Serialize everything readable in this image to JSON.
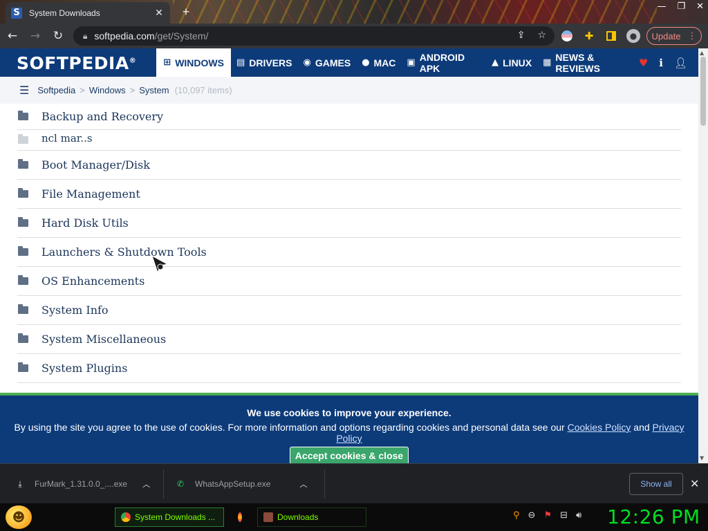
{
  "browser": {
    "tab_title": "System Downloads",
    "tab_favicon": "S",
    "url_host": "softpedia.com",
    "url_path": "/get/System/",
    "update_label": "Update",
    "window_controls": [
      "—",
      "❐",
      "✕"
    ]
  },
  "site": {
    "logo": "SOFTPEDIA",
    "logo_mark": "®",
    "nav": [
      {
        "label": "WINDOWS",
        "icon": "windows-icon",
        "active": true
      },
      {
        "label": "DRIVERS",
        "icon": "drivers-icon"
      },
      {
        "label": "GAMES",
        "icon": "gamepad-icon"
      },
      {
        "label": "MAC",
        "icon": "apple-icon"
      },
      {
        "label": "ANDROID APK",
        "icon": "android-icon"
      },
      {
        "label": "LINUX",
        "icon": "linux-icon"
      },
      {
        "label": "NEWS & REVIEWS",
        "icon": "news-icon"
      }
    ]
  },
  "breadcrumb": {
    "items": [
      "Softpedia",
      "Windows",
      "System"
    ],
    "separator": ">",
    "count": "(10,097 items)"
  },
  "categories": [
    "Backup and Recovery",
    "ncl mar..s",
    "Boot Manager/Disk",
    "File Management",
    "Hard Disk Utils",
    "Launchers & Shutdown Tools",
    "OS Enhancements",
    "System Info",
    "System Miscellaneous",
    "System Plugins"
  ],
  "cookie": {
    "title": "We use cookies to improve your experience.",
    "text": "By using the site you agree to the use of cookies. For more information and options regarding cookies and personal data see our",
    "link_policy": "Cookies Policy",
    "and": "and",
    "link_privacy": "Privacy Policy",
    "accept": "Accept cookies & close"
  },
  "downloads": {
    "items": [
      {
        "name": "FurMark_1.31.0.0_....exe",
        "icon": "installer-icon"
      },
      {
        "name": "WhatsAppSetup.exe",
        "icon": "whatsapp-icon"
      }
    ],
    "show_all": "Show all"
  },
  "taskbar": {
    "tasks": [
      {
        "label": "System Downloads ...",
        "icon": "chrome-icon"
      },
      {
        "label": "",
        "icon": "firefox-icon"
      },
      {
        "label": "Downloads",
        "icon": "folder-icon"
      }
    ],
    "clock": "12:26 PM"
  },
  "colors": {
    "brand_blue": "#0d3b7a",
    "accept_green": "#3aa66b",
    "clock_green": "#00e020"
  }
}
